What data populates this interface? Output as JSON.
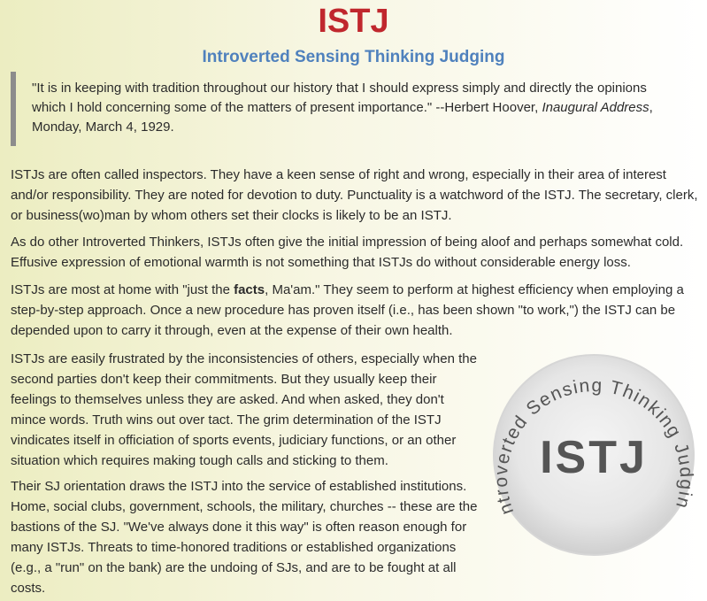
{
  "header": {
    "title": "ISTJ",
    "subtitle": "Introverted Sensing Thinking Judging"
  },
  "quote": {
    "text": "\"It is in keeping with tradition throughout our history that I should express simply and directly the opinions which I hold concerning some of the matters of present importance.\" --Herbert Hoover, ",
    "source": "Inaugural Address",
    "date": ", Monday, March 4, 1929."
  },
  "paragraphs": {
    "p1": "ISTJs are often called inspectors. They have a keen sense of right and wrong, especially in their area of interest and/or responsibility. They are noted for devotion to duty. Punctuality is a watchword of the ISTJ. The secretary, clerk, or business(wo)man by whom others set their clocks is likely to be an ISTJ.",
    "p2": "As do other Introverted Thinkers, ISTJs often give the initial impression of being aloof and perhaps somewhat cold. Effusive expression of emotional warmth is not something that ISTJs do without considerable energy loss.",
    "p3_pre": "ISTJs are most at home with \"just the ",
    "p3_bold": "facts",
    "p3_post": ", Ma'am.\" They seem to perform at highest efficiency when employing a step-by-step approach. Once a new procedure has proven itself (i.e., has been shown \"to work,\") the ISTJ can be depended upon to carry it through, even at the expense of their own health.",
    "p4": "ISTJs are easily frustrated by the inconsistencies of others, especially when the second parties don't keep their commitments. But they usually keep their feelings to themselves unless they are asked. And when asked, they don't mince words. Truth wins out over tact. The grim determination of the ISTJ vindicates itself in officiation of sports events, judiciary functions, or an other situation which requires making tough calls and sticking to them.",
    "p5": "Their SJ orientation draws the ISTJ into the service of established institutions. Home, social clubs, government, schools, the military, churches -- these are the bastions of the SJ. \"We've always done it this way\" is often reason enough for many ISTJs. Threats to time-honored traditions or established organizations (e.g., a \"run\" on the bank) are the undoing of SJs, and are to be fought at all costs."
  },
  "badge": {
    "center_text": "ISTJ",
    "ring_text": "Introverted Sensing Thinking Judging"
  },
  "colors": {
    "title": "#c0272d",
    "subtitle": "#4f81bd",
    "quote_bar": "#8c8c8c",
    "badge_text": "#555555"
  }
}
